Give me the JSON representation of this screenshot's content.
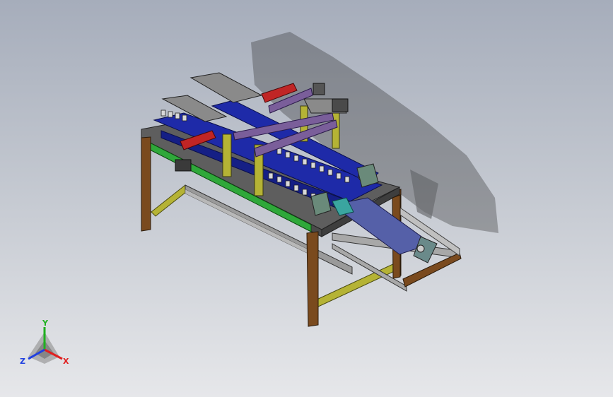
{
  "viewport": {
    "background_top": "#a6adbb",
    "background_bottom": "#e6e7ea",
    "model": "conveyor-assembly-machine"
  },
  "triad": {
    "x_label": "X",
    "y_label": "Y",
    "z_label": "Z",
    "x_color": "#e02020",
    "y_color": "#20b020",
    "z_color": "#2040e0"
  },
  "colors": {
    "table_legs": "#7a4a1e",
    "table_top": "#5e5e5e",
    "green_rail": "#2fa83a",
    "yellow_brace": "#b5b335",
    "blue_track": "#1e2aa8",
    "purple_beam": "#7a5e9a",
    "red_cylinder": "#c02525",
    "gray_frame": "#9a9a9a",
    "teal_plate": "#3aa5a0"
  }
}
